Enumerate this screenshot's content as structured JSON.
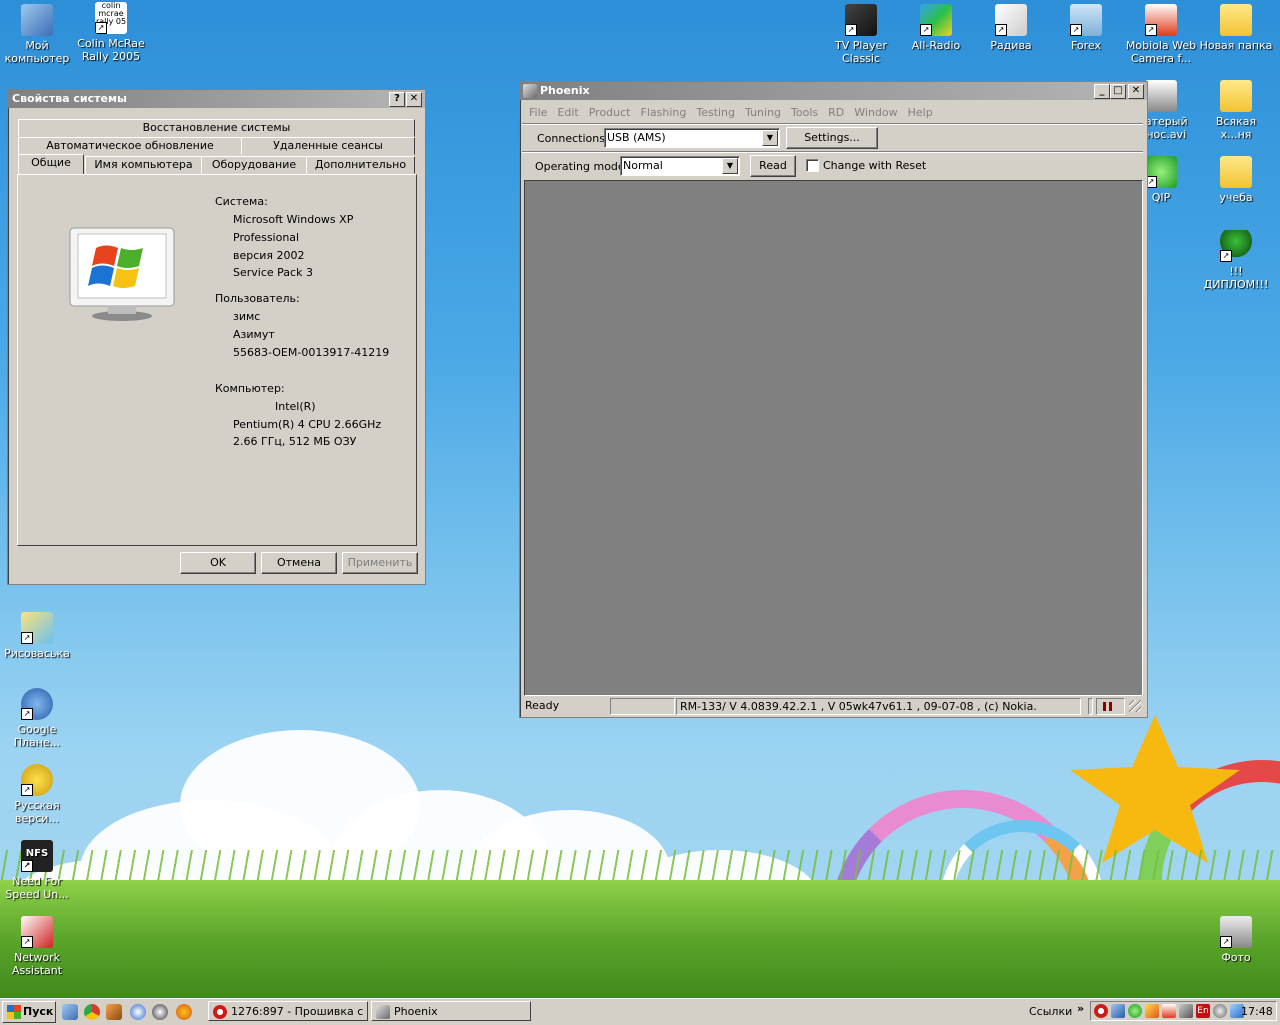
{
  "desktop": {
    "icons_left": [
      {
        "label": "Мой компьютер"
      },
      {
        "label": "Colin McRae Rally 2005",
        "image_text": "colin mcrae rally 05"
      },
      {
        "label": "Рисоваська"
      },
      {
        "label": "Google Плане..."
      },
      {
        "label": "Русская верси..."
      },
      {
        "label": "Need For Speed Un...",
        "image_text": "NFS"
      },
      {
        "label": "Network Assistant"
      }
    ],
    "icons_right": [
      {
        "label": "TV Player Classic"
      },
      {
        "label": "All-Radio"
      },
      {
        "label": "Радива"
      },
      {
        "label": "Forex"
      },
      {
        "label": "Mobiola Web Camera f..."
      },
      {
        "label": "Новая папка"
      },
      {
        "label": "...атерый ...нос.avi"
      },
      {
        "label": "Всякая х...ня"
      },
      {
        "label": "QIP"
      },
      {
        "label": "учеба"
      },
      {
        "label": "!!!ДИПЛОМ!!!"
      },
      {
        "label": "Фото"
      }
    ]
  },
  "sysprops": {
    "title": "Свойства системы",
    "tabs_row1": [
      "Восстановление системы"
    ],
    "tabs_row2": [
      "Автоматическое обновление",
      "Удаленные сеансы"
    ],
    "tabs_row3": [
      "Общие",
      "Имя компьютера",
      "Оборудование",
      "Дополнительно"
    ],
    "active_tab": "Общие",
    "system_label": "Система:",
    "system_lines": [
      "Microsoft Windows XP",
      "Professional",
      "версия 2002",
      "Service Pack 3"
    ],
    "user_label": "Пользователь:",
    "user_lines": [
      "зимс",
      "Азимут",
      "55683-OEM-0013917-41219"
    ],
    "computer_label": "Компьютер:",
    "computer_lines": [
      "Intel(R)",
      "Pentium(R) 4 CPU 2.66GHz",
      "2.66 ГГц, 512 МБ ОЗУ"
    ],
    "buttons": {
      "ok": "OK",
      "cancel": "Отмена",
      "apply": "Применить"
    },
    "title_buttons": {
      "help": "?",
      "close": "✕"
    }
  },
  "phoenix": {
    "title": "Phoenix",
    "menu": [
      "File",
      "Edit",
      "Product",
      "Flashing",
      "Testing",
      "Tuning",
      "Tools",
      "RD",
      "Window",
      "Help"
    ],
    "connections_label": "Connections:",
    "connections_value": "USB (AMS)",
    "settings_button": "Settings...",
    "opmode_label": "Operating mode:",
    "opmode_value": "Normal",
    "read_button": "Read",
    "change_with_reset": "Change with Reset",
    "status_ready": "Ready",
    "status_version": "RM-133/ V 4.0839.42.2.1 , V 05wk47v61.1 , 09-07-08 , (c) Nokia.",
    "title_buttons": {
      "minimize": "_",
      "maximize": "□",
      "close": "✕"
    }
  },
  "taskbar": {
    "start_label": "Пуск",
    "tasks": [
      {
        "label": "1276:897 - Прошивка с ..."
      },
      {
        "label": "Phoenix"
      }
    ],
    "links_label": "Ссылки",
    "links_chevron": "»",
    "lang": "En",
    "clock": "17:48"
  },
  "colors": {
    "title_inactive_start": "#808080",
    "title_inactive_end": "#b5b5b5",
    "face": "#d4d0c8",
    "mdi_bg": "#808080"
  }
}
